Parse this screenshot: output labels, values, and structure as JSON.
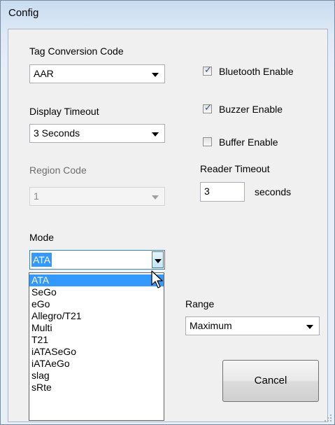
{
  "window": {
    "title": "Config"
  },
  "tag_conversion": {
    "label": "Tag Conversion Code",
    "value": "AAR"
  },
  "display_timeout": {
    "label": "Display Timeout",
    "value": "3 Seconds"
  },
  "region_code": {
    "label": "Region Code",
    "value": "1"
  },
  "checkboxes": [
    {
      "label": "Bluetooth Enable",
      "checked": true
    },
    {
      "label": "Buzzer Enable",
      "checked": true
    },
    {
      "label": "Buffer Enable",
      "checked": false
    }
  ],
  "reader_timeout": {
    "label": "Reader Timeout",
    "value": "3",
    "unit": "seconds"
  },
  "mode": {
    "label": "Mode",
    "value": "ATA",
    "options": [
      "ATA",
      "SeGo",
      "eGo",
      "Allegro/T21",
      "Multi",
      "T21",
      "iATASeGo",
      "iATAeGo",
      "slag",
      "sRte"
    ]
  },
  "range": {
    "label": "Range",
    "value": "Maximum"
  },
  "buttons": {
    "cancel": "Cancel"
  },
  "colors": {
    "selection": "#3399ff",
    "title_bar": "#c9dcf0"
  }
}
